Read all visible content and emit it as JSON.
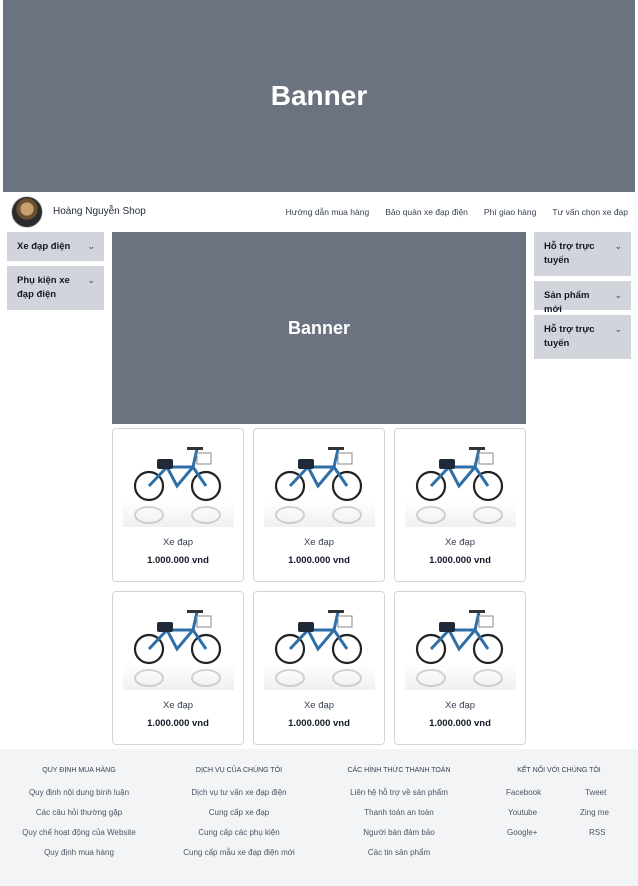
{
  "top_banner": {
    "label": "Banner"
  },
  "nav": {
    "shop_name": "Hoàng Nguyễn Shop",
    "links": [
      "Hướng dẫn mua hàng",
      "Bảo quản xe đạp điện",
      "Phí giao hàng",
      "Tư vấn chọn xe đạp"
    ]
  },
  "left_menu": [
    {
      "label": "Xe đạp điện"
    },
    {
      "label": "Phụ kiện xe đạp điện"
    }
  ],
  "right_menu": [
    {
      "label": "Hỗ trợ trực tuyến"
    },
    {
      "label": "Sản phẩm mới"
    },
    {
      "label": "Hỗ trợ trực tuyến"
    }
  ],
  "mid_banner": {
    "label": "Banner"
  },
  "products": [
    {
      "name": "Xe đạp",
      "price": "1.000.000 vnd"
    },
    {
      "name": "Xe đạp",
      "price": "1.000.000 vnd"
    },
    {
      "name": "Xe đạp",
      "price": "1.000.000 vnd"
    },
    {
      "name": "Xe đạp",
      "price": "1.000.000 vnd"
    },
    {
      "name": "Xe đạp",
      "price": "1.000.000 vnd"
    },
    {
      "name": "Xe đạp",
      "price": "1.000.000 vnd"
    }
  ],
  "footer": {
    "col1": {
      "heading": "Quy định mua hàng",
      "links": [
        "Quy định nội dung bình luận",
        "Các câu hỏi thường gặp",
        "Quy chế hoạt động của Website",
        "Quy định mua hàng"
      ]
    },
    "col2": {
      "heading": "Dịch vụ của chúng tôi",
      "links": [
        "Dịch vụ tư vấn xe đạp điện",
        "Cung cấp xe đạp",
        "Cung cấp các phụ kiện",
        "Cung cấp mẫu xe đạp điện mới"
      ]
    },
    "col3": {
      "heading": "Các hình thức thanh toán",
      "links": [
        "Liên hệ hỗ trợ về sản phẩm",
        "Thanh toán an toàn",
        "Người bán đảm bảo",
        "Các tin sản phẩm"
      ]
    },
    "col4": {
      "heading": "Kết nối với chúng tôi",
      "links": [
        "Facebook",
        "Tweet",
        "Youtube",
        "Zing me",
        "Google+",
        "RSS"
      ]
    }
  },
  "colors": {
    "banner": "#6b7280",
    "accordion": "#d1d5db",
    "footer": "#f3f4f6"
  }
}
